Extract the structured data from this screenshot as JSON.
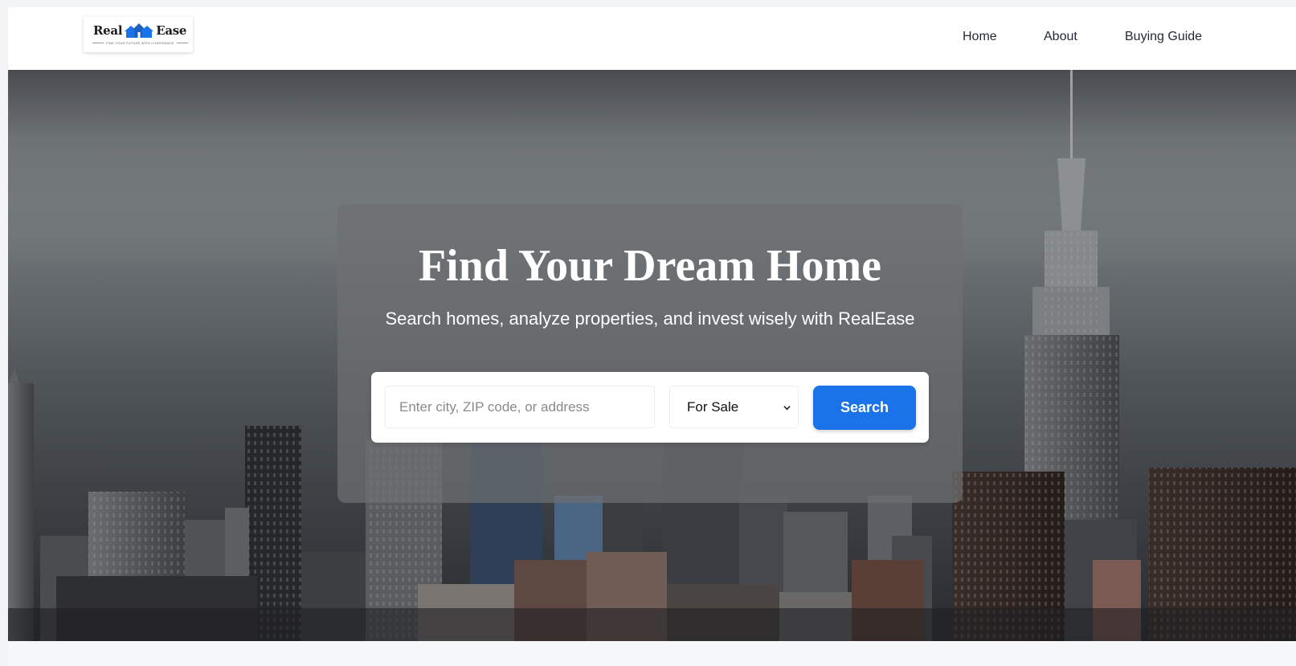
{
  "brand": {
    "name_left": "Real",
    "name_right": "Ease",
    "tagline": "FIND YOUR FUTURE WITH CONFIDENCE",
    "accent_color": "#1a73e8"
  },
  "nav": {
    "items": [
      {
        "label": "Home"
      },
      {
        "label": "About"
      },
      {
        "label": "Buying Guide"
      }
    ]
  },
  "hero": {
    "title": "Find Your Dream Home",
    "subtitle": "Search homes, analyze properties, and invest wisely with RealEase",
    "search": {
      "placeholder": "Enter city, ZIP code, or address",
      "value": "",
      "type_selected": "For Sale",
      "button_label": "Search"
    }
  },
  "icons": {
    "logo": "house-logo-icon",
    "select": "chevron-down-icon"
  }
}
